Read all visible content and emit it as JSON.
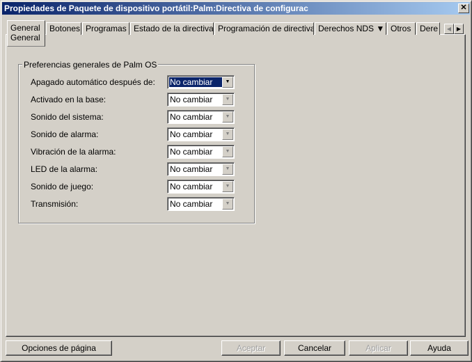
{
  "window": {
    "title": "Propiedades de Paquete de dispositivo portátil:Palm:Directiva de configurac",
    "close": "✕"
  },
  "tabs": [
    {
      "label": "General",
      "sub": "General"
    },
    {
      "label": "Botones"
    },
    {
      "label": "Programas"
    },
    {
      "label": "Estado de la directiva"
    },
    {
      "label": "Programación de directivas"
    },
    {
      "label": "Derechos NDS ▼"
    },
    {
      "label": "Otros"
    },
    {
      "label": "Dere"
    }
  ],
  "group": {
    "title": "Preferencias generales de Palm OS",
    "rows": [
      {
        "label": "Apagado automático después de:",
        "value": "No cambiar"
      },
      {
        "label": "Activado en la base:",
        "value": "No cambiar"
      },
      {
        "label": "Sonido del sistema:",
        "value": "No cambiar"
      },
      {
        "label": "Sonido de alarma:",
        "value": "No cambiar"
      },
      {
        "label": "Vibración de la alarma:",
        "value": "No cambiar"
      },
      {
        "label": "LED de la alarma:",
        "value": "No cambiar"
      },
      {
        "label": "Sonido de juego:",
        "value": "No cambiar"
      },
      {
        "label": "Transmisión:",
        "value": "No cambiar"
      }
    ]
  },
  "buttons": {
    "page_options": "Opciones de página",
    "ok": "Aceptar",
    "cancel": "Cancelar",
    "apply": "Aplicar",
    "help": "Ayuda"
  }
}
